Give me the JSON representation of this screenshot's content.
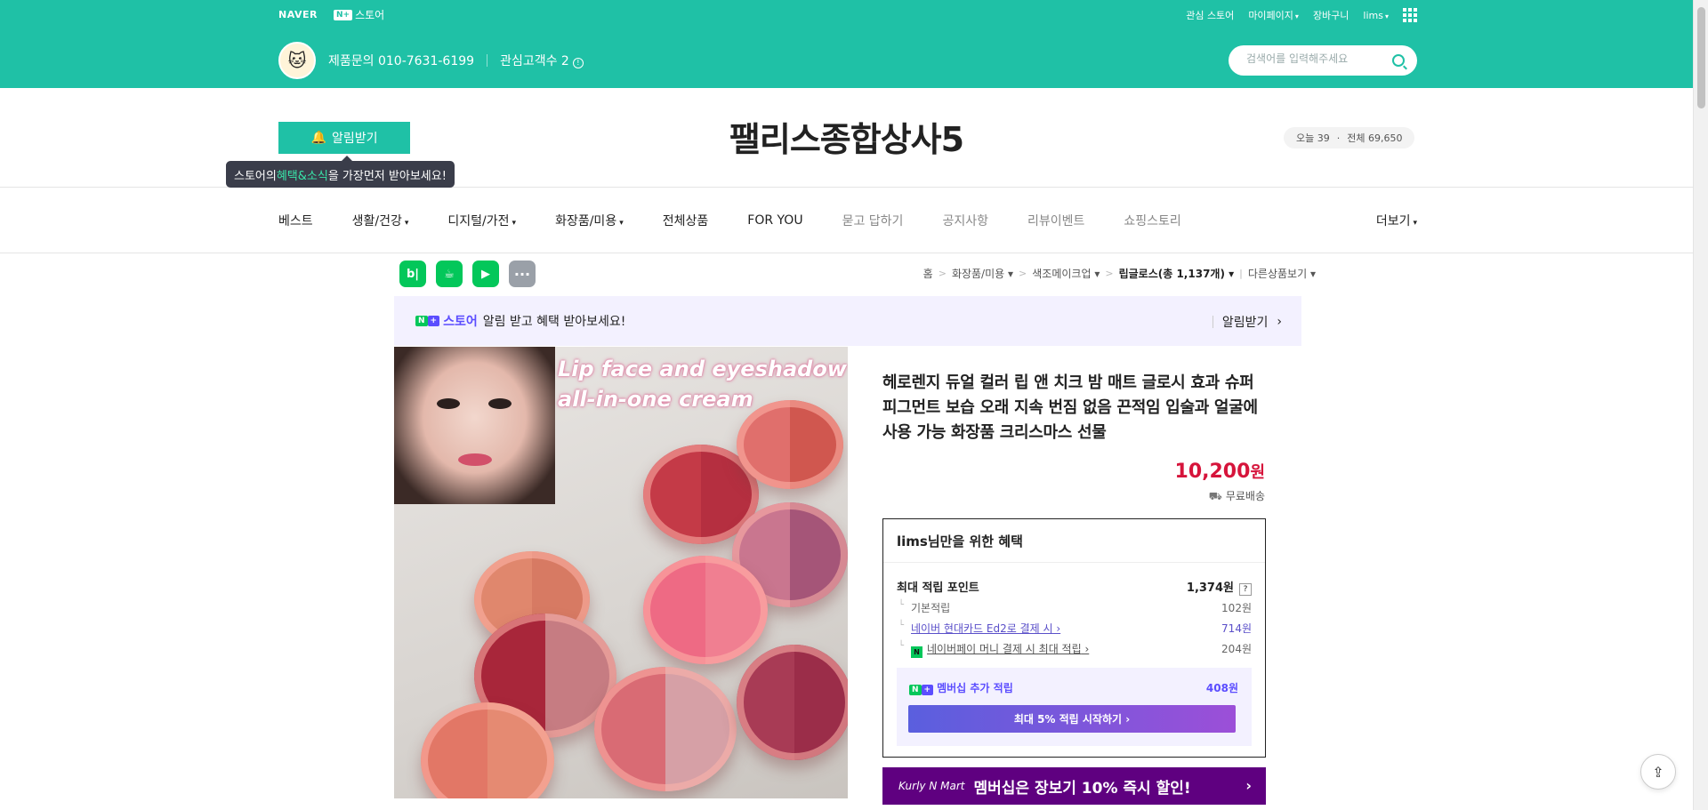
{
  "gnb": {
    "naver": "NAVER",
    "nplus_box": "N+",
    "nplus_label": "스토어",
    "util": [
      "관심 스토어",
      "마이페이지",
      "장바구니",
      "lims"
    ],
    "contact": "제품문의 010-7631-6199",
    "fans": "관심고객수 2",
    "search_placeholder": "검색어를 입력해주세요"
  },
  "store": {
    "alert_button": "알림받기",
    "tooltip_pre": "스토어의 ",
    "tooltip_hl": "혜택&소식",
    "tooltip_post": "을 가장먼저 받아보세요!",
    "title": "팰리스종합상사5",
    "today": "오늘 39",
    "total": "전체 69,650"
  },
  "nav": {
    "items": [
      "베스트",
      "생활/건강",
      "디지털/가전",
      "화장품/미용",
      "전체상품",
      "FOR YOU",
      "묻고 답하기",
      "공지사항",
      "리뷰이벤트",
      "쇼핑스토리"
    ],
    "more": "더보기"
  },
  "sns": {
    "blog": "b|",
    "more": "···"
  },
  "breadcrumb": [
    "홈",
    "화장품/미용",
    "색조메이크업",
    "립글로스(총 1,137개)",
    "다른상품보기"
  ],
  "member_banner": {
    "badge": "스토어",
    "text": "알림 받고 혜택 받아보세요!",
    "right": "알림받기"
  },
  "image": {
    "overlay_line1": "Lip face and eyeshadow",
    "overlay_line2": "all-in-one cream"
  },
  "product": {
    "title": "헤로렌지 듀얼 컬러 립 앤 치크 밤 매트 글로시 효과 슈퍼 피그먼트 보습 오래 지속 번짐 없음 끈적임 입술과 얼굴에 사용 가능 화장품 크리스마스 선물",
    "price_num": "10,200",
    "price_unit": "원",
    "shipping": "무료배송"
  },
  "benefit": {
    "header": "lims님만을 위한 혜택",
    "max_label": "최대 적립 포인트",
    "max_value": "1,374원",
    "basic_label": "기본적립",
    "basic_value": "102원",
    "card_label": "네이버 현대카드 Ed2로 결제 시",
    "card_value": "714원",
    "pay_label": "네이버페이 머니 결제 시 최대 적립",
    "pay_value": "204원",
    "membership_label": "멤버십 추가 적립",
    "membership_value": "408원",
    "cta": "최대 5% 적립 시작하기"
  },
  "kurly": {
    "logo": "Kurly N Mart",
    "text": "멤버십은 장보기 10% 즉시 할인!"
  }
}
